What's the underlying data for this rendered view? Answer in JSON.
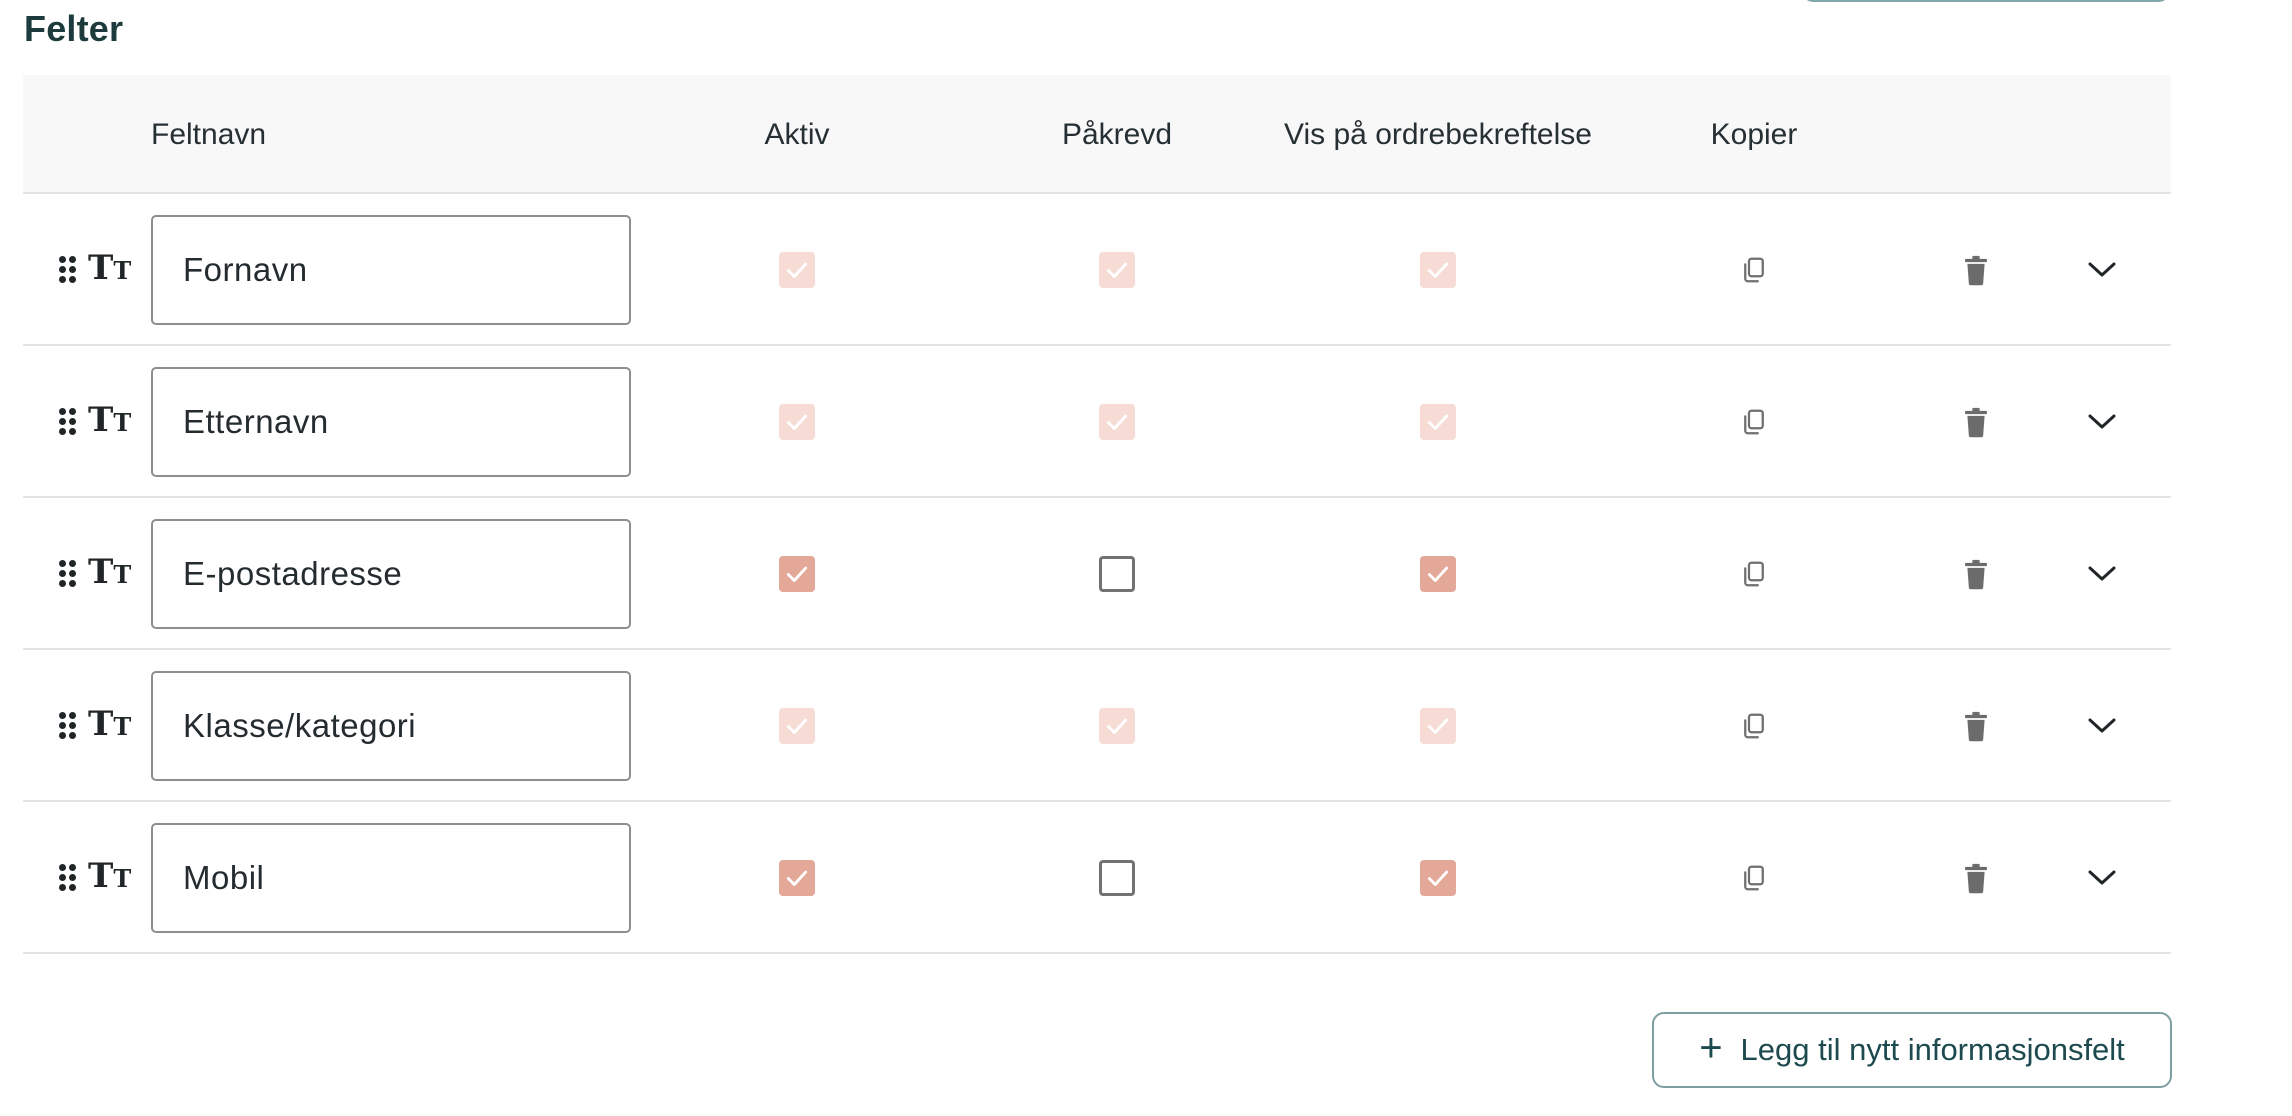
{
  "section_title": "Felter",
  "columns": {
    "name": "Feltnavn",
    "active": "Aktiv",
    "required": "Påkrevd",
    "show_on_confirmation": "Vis på ordrebekreftelse",
    "copy": "Kopier"
  },
  "field_type_icon": "text-type-icon",
  "rows": [
    {
      "name": "Fornavn",
      "active": "checked-disabled",
      "required": "checked-disabled",
      "show_on_confirmation": "checked-disabled"
    },
    {
      "name": "Etternavn",
      "active": "checked-disabled",
      "required": "checked-disabled",
      "show_on_confirmation": "checked-disabled"
    },
    {
      "name": "E-postadresse",
      "active": "checked",
      "required": "unchecked",
      "show_on_confirmation": "checked"
    },
    {
      "name": "Klasse/kategori",
      "active": "checked-disabled",
      "required": "checked-disabled",
      "show_on_confirmation": "checked-disabled"
    },
    {
      "name": "Mobil",
      "active": "checked",
      "required": "unchecked",
      "show_on_confirmation": "checked"
    }
  ],
  "add_button": {
    "icon": "+",
    "label": "Legg til nytt informasjonsfelt"
  },
  "colors": {
    "title": "#1d3b3c",
    "checkbox_checked": "#e3a898",
    "checkbox_disabled": "#f6dcd5",
    "button_border": "#7d9fa1",
    "button_text": "#1d4a4e"
  }
}
